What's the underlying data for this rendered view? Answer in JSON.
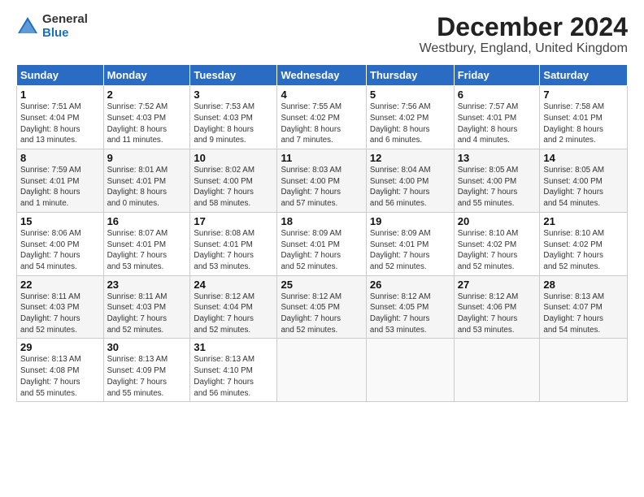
{
  "logo": {
    "general": "General",
    "blue": "Blue"
  },
  "header": {
    "title": "December 2024",
    "subtitle": "Westbury, England, United Kingdom"
  },
  "weekdays": [
    "Sunday",
    "Monday",
    "Tuesday",
    "Wednesday",
    "Thursday",
    "Friday",
    "Saturday"
  ],
  "weeks": [
    [
      {
        "day": "1",
        "info": "Sunrise: 7:51 AM\nSunset: 4:04 PM\nDaylight: 8 hours\nand 13 minutes."
      },
      {
        "day": "2",
        "info": "Sunrise: 7:52 AM\nSunset: 4:03 PM\nDaylight: 8 hours\nand 11 minutes."
      },
      {
        "day": "3",
        "info": "Sunrise: 7:53 AM\nSunset: 4:03 PM\nDaylight: 8 hours\nand 9 minutes."
      },
      {
        "day": "4",
        "info": "Sunrise: 7:55 AM\nSunset: 4:02 PM\nDaylight: 8 hours\nand 7 minutes."
      },
      {
        "day": "5",
        "info": "Sunrise: 7:56 AM\nSunset: 4:02 PM\nDaylight: 8 hours\nand 6 minutes."
      },
      {
        "day": "6",
        "info": "Sunrise: 7:57 AM\nSunset: 4:01 PM\nDaylight: 8 hours\nand 4 minutes."
      },
      {
        "day": "7",
        "info": "Sunrise: 7:58 AM\nSunset: 4:01 PM\nDaylight: 8 hours\nand 2 minutes."
      }
    ],
    [
      {
        "day": "8",
        "info": "Sunrise: 7:59 AM\nSunset: 4:01 PM\nDaylight: 8 hours\nand 1 minute."
      },
      {
        "day": "9",
        "info": "Sunrise: 8:01 AM\nSunset: 4:01 PM\nDaylight: 8 hours\nand 0 minutes."
      },
      {
        "day": "10",
        "info": "Sunrise: 8:02 AM\nSunset: 4:00 PM\nDaylight: 7 hours\nand 58 minutes."
      },
      {
        "day": "11",
        "info": "Sunrise: 8:03 AM\nSunset: 4:00 PM\nDaylight: 7 hours\nand 57 minutes."
      },
      {
        "day": "12",
        "info": "Sunrise: 8:04 AM\nSunset: 4:00 PM\nDaylight: 7 hours\nand 56 minutes."
      },
      {
        "day": "13",
        "info": "Sunrise: 8:05 AM\nSunset: 4:00 PM\nDaylight: 7 hours\nand 55 minutes."
      },
      {
        "day": "14",
        "info": "Sunrise: 8:05 AM\nSunset: 4:00 PM\nDaylight: 7 hours\nand 54 minutes."
      }
    ],
    [
      {
        "day": "15",
        "info": "Sunrise: 8:06 AM\nSunset: 4:00 PM\nDaylight: 7 hours\nand 54 minutes."
      },
      {
        "day": "16",
        "info": "Sunrise: 8:07 AM\nSunset: 4:01 PM\nDaylight: 7 hours\nand 53 minutes."
      },
      {
        "day": "17",
        "info": "Sunrise: 8:08 AM\nSunset: 4:01 PM\nDaylight: 7 hours\nand 53 minutes."
      },
      {
        "day": "18",
        "info": "Sunrise: 8:09 AM\nSunset: 4:01 PM\nDaylight: 7 hours\nand 52 minutes."
      },
      {
        "day": "19",
        "info": "Sunrise: 8:09 AM\nSunset: 4:01 PM\nDaylight: 7 hours\nand 52 minutes."
      },
      {
        "day": "20",
        "info": "Sunrise: 8:10 AM\nSunset: 4:02 PM\nDaylight: 7 hours\nand 52 minutes."
      },
      {
        "day": "21",
        "info": "Sunrise: 8:10 AM\nSunset: 4:02 PM\nDaylight: 7 hours\nand 52 minutes."
      }
    ],
    [
      {
        "day": "22",
        "info": "Sunrise: 8:11 AM\nSunset: 4:03 PM\nDaylight: 7 hours\nand 52 minutes."
      },
      {
        "day": "23",
        "info": "Sunrise: 8:11 AM\nSunset: 4:03 PM\nDaylight: 7 hours\nand 52 minutes."
      },
      {
        "day": "24",
        "info": "Sunrise: 8:12 AM\nSunset: 4:04 PM\nDaylight: 7 hours\nand 52 minutes."
      },
      {
        "day": "25",
        "info": "Sunrise: 8:12 AM\nSunset: 4:05 PM\nDaylight: 7 hours\nand 52 minutes."
      },
      {
        "day": "26",
        "info": "Sunrise: 8:12 AM\nSunset: 4:05 PM\nDaylight: 7 hours\nand 53 minutes."
      },
      {
        "day": "27",
        "info": "Sunrise: 8:12 AM\nSunset: 4:06 PM\nDaylight: 7 hours\nand 53 minutes."
      },
      {
        "day": "28",
        "info": "Sunrise: 8:13 AM\nSunset: 4:07 PM\nDaylight: 7 hours\nand 54 minutes."
      }
    ],
    [
      {
        "day": "29",
        "info": "Sunrise: 8:13 AM\nSunset: 4:08 PM\nDaylight: 7 hours\nand 55 minutes."
      },
      {
        "day": "30",
        "info": "Sunrise: 8:13 AM\nSunset: 4:09 PM\nDaylight: 7 hours\nand 55 minutes."
      },
      {
        "day": "31",
        "info": "Sunrise: 8:13 AM\nSunset: 4:10 PM\nDaylight: 7 hours\nand 56 minutes."
      },
      {
        "day": "",
        "info": ""
      },
      {
        "day": "",
        "info": ""
      },
      {
        "day": "",
        "info": ""
      },
      {
        "day": "",
        "info": ""
      }
    ]
  ]
}
